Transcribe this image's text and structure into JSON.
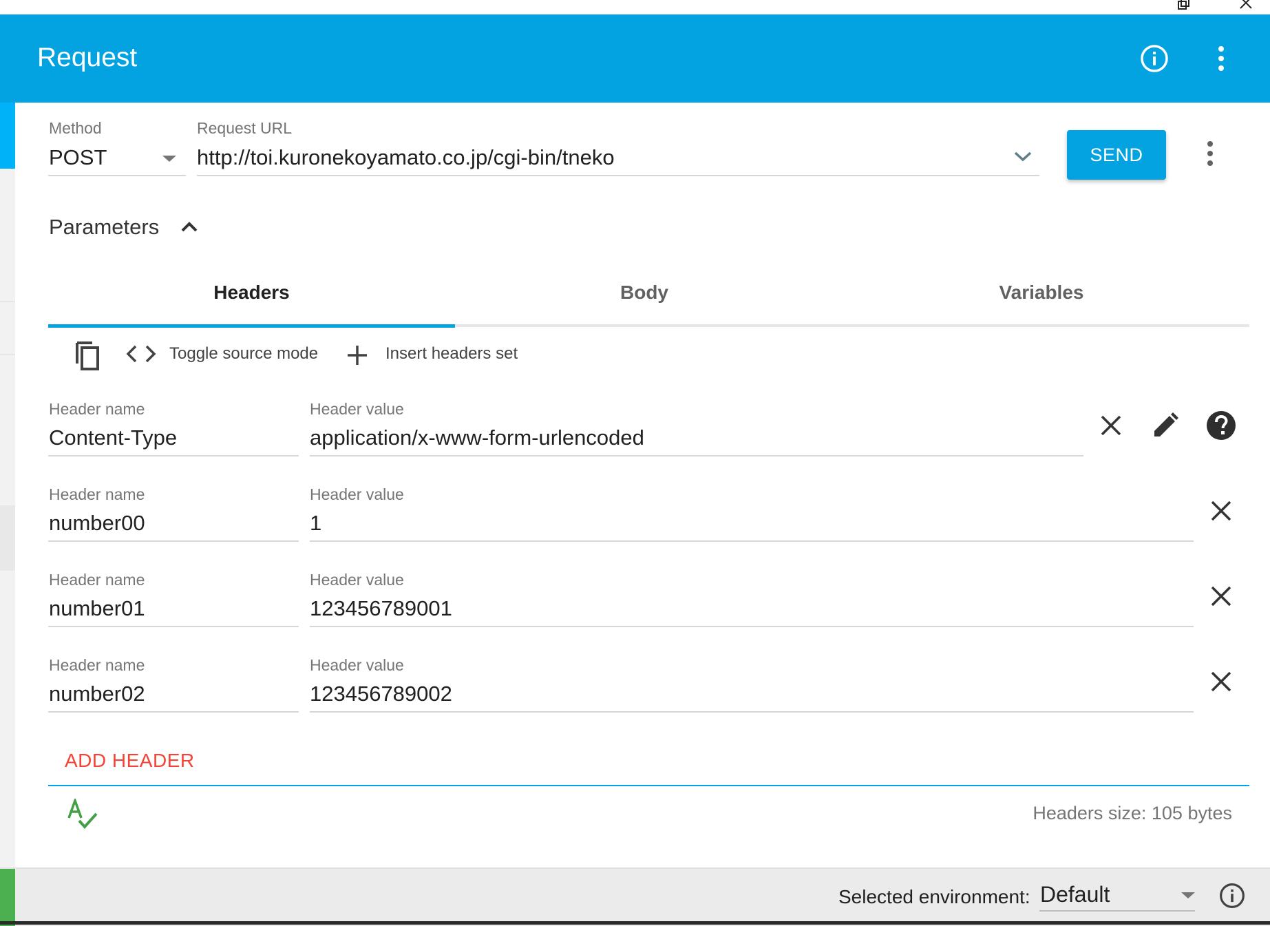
{
  "appbar": {
    "title": "Request",
    "info_icon": "info-icon",
    "menu_icon": "more-vert-icon"
  },
  "request": {
    "method_label": "Method",
    "method_value": "POST",
    "url_label": "Request URL",
    "url_value": "http://toi.kuronekoyamato.co.jp/cgi-bin/tneko",
    "send_label": "SEND"
  },
  "parameters": {
    "label": "Parameters"
  },
  "tabs": [
    {
      "label": "Headers",
      "active": true
    },
    {
      "label": "Body",
      "active": false
    },
    {
      "label": "Variables",
      "active": false
    }
  ],
  "toolbar": {
    "toggle_source_label": "Toggle source mode",
    "insert_headers_label": "Insert headers set"
  },
  "headers": [
    {
      "name_label": "Header name",
      "name": "Content-Type",
      "value_label": "Header value",
      "value": "application/x-www-form-urlencoded"
    },
    {
      "name_label": "Header name",
      "name": "number00",
      "value_label": "Header value",
      "value": "1"
    },
    {
      "name_label": "Header name",
      "name": "number01",
      "value_label": "Header value",
      "value": "123456789001"
    },
    {
      "name_label": "Header name",
      "name": "number02",
      "value_label": "Header value",
      "value": "123456789002"
    }
  ],
  "add_header_label": "ADD HEADER",
  "headers_size": "Headers size: 105 bytes",
  "footer": {
    "env_label": "Selected environment:",
    "env_value": "Default"
  },
  "colors": {
    "primary": "#03a2e1",
    "accent_red": "#f44336",
    "status_green": "#4caf50"
  }
}
